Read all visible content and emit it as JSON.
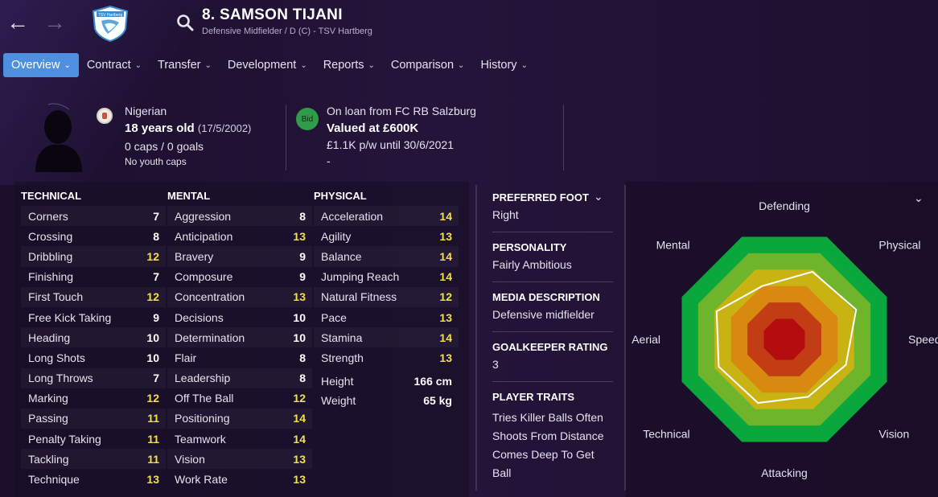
{
  "header": {
    "player_name": "8. SAMSON TIJANI",
    "player_sub": "Defensive Midfielder / D (C) - TSV Hartberg",
    "crest_text": "TSV Hartberg"
  },
  "tabs": [
    {
      "label": "Overview",
      "active": true
    },
    {
      "label": "Contract"
    },
    {
      "label": "Transfer"
    },
    {
      "label": "Development"
    },
    {
      "label": "Reports"
    },
    {
      "label": "Comparison"
    },
    {
      "label": "History"
    }
  ],
  "profile": {
    "nationality": "Nigerian",
    "age": "18 years old",
    "dob": "(17/5/2002)",
    "caps": "0 caps / 0 goals",
    "youth_caps": "No youth caps",
    "bid_label": "Bid",
    "loan": "On loan from FC RB Salzburg",
    "value": "Valued at £600K",
    "wage": "£1.1K p/w until 30/6/2021",
    "extra": "-"
  },
  "attributes": {
    "technical": {
      "title": "TECHNICAL",
      "items": [
        {
          "name": "Corners",
          "value": "7"
        },
        {
          "name": "Crossing",
          "value": "8"
        },
        {
          "name": "Dribbling",
          "value": "12",
          "hi": true
        },
        {
          "name": "Finishing",
          "value": "7"
        },
        {
          "name": "First Touch",
          "value": "12",
          "hi": true
        },
        {
          "name": "Free Kick Taking",
          "value": "9"
        },
        {
          "name": "Heading",
          "value": "10"
        },
        {
          "name": "Long Shots",
          "value": "10"
        },
        {
          "name": "Long Throws",
          "value": "7"
        },
        {
          "name": "Marking",
          "value": "12",
          "hi": true
        },
        {
          "name": "Passing",
          "value": "11",
          "hi": true
        },
        {
          "name": "Penalty Taking",
          "value": "11",
          "hi": true
        },
        {
          "name": "Tackling",
          "value": "11",
          "hi": true
        },
        {
          "name": "Technique",
          "value": "13",
          "hi": true
        }
      ]
    },
    "mental": {
      "title": "MENTAL",
      "items": [
        {
          "name": "Aggression",
          "value": "8"
        },
        {
          "name": "Anticipation",
          "value": "13",
          "hi": true
        },
        {
          "name": "Bravery",
          "value": "9"
        },
        {
          "name": "Composure",
          "value": "9"
        },
        {
          "name": "Concentration",
          "value": "13",
          "hi": true
        },
        {
          "name": "Decisions",
          "value": "10"
        },
        {
          "name": "Determination",
          "value": "10"
        },
        {
          "name": "Flair",
          "value": "8"
        },
        {
          "name": "Leadership",
          "value": "8"
        },
        {
          "name": "Off The Ball",
          "value": "12",
          "hi": true
        },
        {
          "name": "Positioning",
          "value": "14",
          "hi": true
        },
        {
          "name": "Teamwork",
          "value": "14",
          "hi": true
        },
        {
          "name": "Vision",
          "value": "13",
          "hi": true
        },
        {
          "name": "Work Rate",
          "value": "13",
          "hi": true
        }
      ]
    },
    "physical": {
      "title": "PHYSICAL",
      "items": [
        {
          "name": "Acceleration",
          "value": "14",
          "hi": true
        },
        {
          "name": "Agility",
          "value": "13",
          "hi": true
        },
        {
          "name": "Balance",
          "value": "14",
          "hi": true
        },
        {
          "name": "Jumping Reach",
          "value": "14",
          "hi": true
        },
        {
          "name": "Natural Fitness",
          "value": "12",
          "hi": true
        },
        {
          "name": "Pace",
          "value": "13",
          "hi": true
        },
        {
          "name": "Stamina",
          "value": "14",
          "hi": true
        },
        {
          "name": "Strength",
          "value": "13",
          "hi": true
        }
      ],
      "height_label": "Height",
      "height_value": "166 cm",
      "weight_label": "Weight",
      "weight_value": "65 kg"
    }
  },
  "details": {
    "foot_title": "PREFERRED FOOT",
    "foot_value": "Right",
    "personality_title": "PERSONALITY",
    "personality_value": "Fairly Ambitious",
    "media_title": "MEDIA DESCRIPTION",
    "media_value": "Defensive midfielder",
    "gk_title": "GOALKEEPER RATING",
    "gk_value": "3",
    "traits_title": "PLAYER TRAITS",
    "traits": [
      "Tries Killer Balls Often",
      "Shoots From Distance",
      "Comes Deep To Get Ball"
    ]
  },
  "radar": {
    "labels": [
      "Defending",
      "Physical",
      "Speed",
      "Vision",
      "Attacking",
      "Technical",
      "Aerial",
      "Mental"
    ],
    "ring_colors": [
      "#0aa83c",
      "#6fb52c",
      "#c9b313",
      "#d88a10",
      "#c23c14",
      "#b50c10"
    ],
    "player_levels": [
      0.52,
      0.66,
      0.7,
      0.6,
      0.56,
      0.62,
      0.64,
      0.66
    ]
  },
  "colors": {
    "accent_tab": "#4f8fe0",
    "highlight_value": "#f0e04a",
    "bid_green": "#2f9c4a"
  },
  "icons": {
    "back": "arrow-left-icon",
    "forward": "arrow-right-icon",
    "search": "search-icon",
    "chevron": "chevron-down-icon"
  }
}
